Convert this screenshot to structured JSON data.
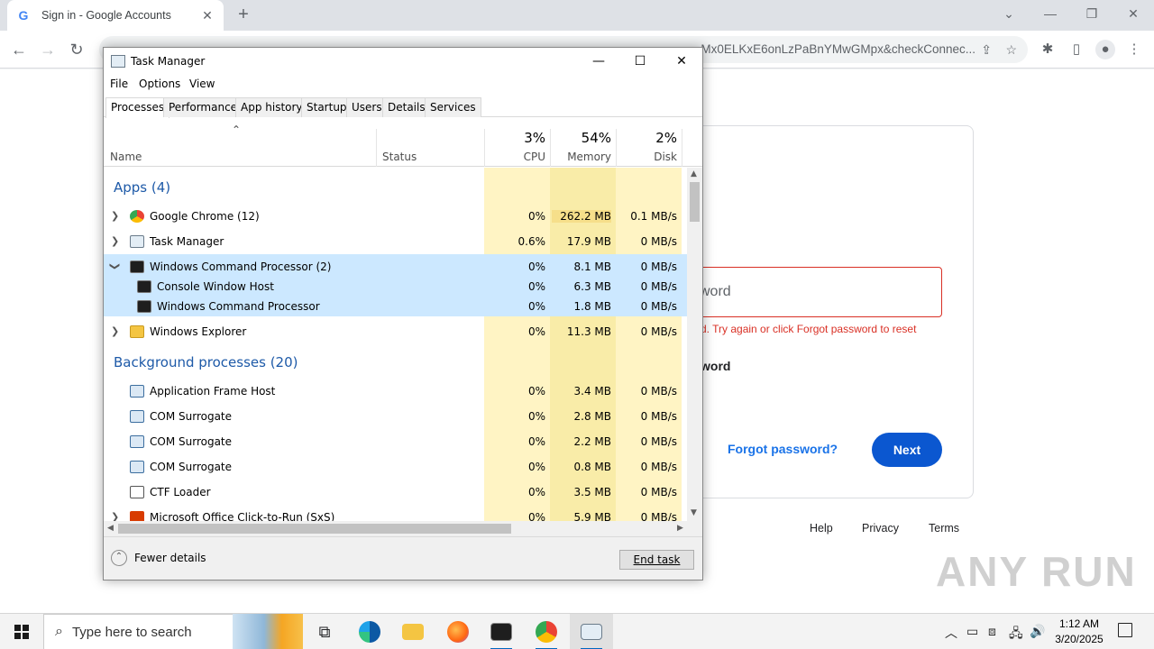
{
  "browser": {
    "tab_title": "Sign in - Google Accounts",
    "tab_favicon": "G",
    "address": "...Mx0ELKxE6onLzPaBnYMwGMpx&checkConnec..."
  },
  "google": {
    "password_placeholder": "Password",
    "password_visible": "sword",
    "error_text": "d. Try again or click Forgot password to reset",
    "show_password_fragment": "word",
    "forgot_password": "Forgot password?",
    "next": "Next",
    "footer": {
      "help": "Help",
      "privacy": "Privacy",
      "terms": "Terms"
    },
    "watermark": "ANY RUN"
  },
  "taskmgr": {
    "title": "Task Manager",
    "menu": [
      "File",
      "Options",
      "View"
    ],
    "tabs": [
      "Processes",
      "Performance",
      "App history",
      "Startup",
      "Users",
      "Details",
      "Services"
    ],
    "columns": {
      "name": "Name",
      "status": "Status",
      "cpu_pct": "3%",
      "cpu": "CPU",
      "mem_pct": "54%",
      "mem": "Memory",
      "disk_pct": "2%",
      "disk": "Disk"
    },
    "groups": {
      "apps": "Apps (4)",
      "background": "Background processes (20)"
    },
    "rows": [
      {
        "name": "Google Chrome (12)",
        "cpu": "0%",
        "mem": "262.2 MB",
        "disk": "0.1 MB/s"
      },
      {
        "name": "Task Manager",
        "cpu": "0.6%",
        "mem": "17.9 MB",
        "disk": "0 MB/s"
      },
      {
        "name": "Windows Command Processor (2)",
        "cpu": "0%",
        "mem": "8.1 MB",
        "disk": "0 MB/s"
      },
      {
        "name": "Console Window Host",
        "cpu": "0%",
        "mem": "6.3 MB",
        "disk": "0 MB/s"
      },
      {
        "name": "Windows Command Processor",
        "cpu": "0%",
        "mem": "1.8 MB",
        "disk": "0 MB/s"
      },
      {
        "name": "Windows Explorer",
        "cpu": "0%",
        "mem": "11.3 MB",
        "disk": "0 MB/s"
      },
      {
        "name": "Application Frame Host",
        "cpu": "0%",
        "mem": "3.4 MB",
        "disk": "0 MB/s"
      },
      {
        "name": "COM Surrogate",
        "cpu": "0%",
        "mem": "2.8 MB",
        "disk": "0 MB/s"
      },
      {
        "name": "COM Surrogate",
        "cpu": "0%",
        "mem": "2.2 MB",
        "disk": "0 MB/s"
      },
      {
        "name": "COM Surrogate",
        "cpu": "0%",
        "mem": "0.8 MB",
        "disk": "0 MB/s"
      },
      {
        "name": "CTF Loader",
        "cpu": "0%",
        "mem": "3.5 MB",
        "disk": "0 MB/s"
      },
      {
        "name": "Microsoft Office Click-to-Run (SxS)",
        "cpu": "0%",
        "mem": "5.9 MB",
        "disk": "0 MB/s"
      }
    ],
    "fewer_details": "Fewer details",
    "end_task": "End task"
  },
  "taskbar": {
    "search_placeholder": "Type here to search",
    "time": "1:12 AM",
    "date": "3/20/2025"
  },
  "colors": {
    "heat_light": "#fff4c4",
    "heat_mid": "#f9eca8",
    "heat_strong": "#f6df8a",
    "selection": "#cce8ff",
    "group_blue": "#1e5aa8",
    "google_blue": "#0b57d0",
    "error_red": "#d93025"
  }
}
